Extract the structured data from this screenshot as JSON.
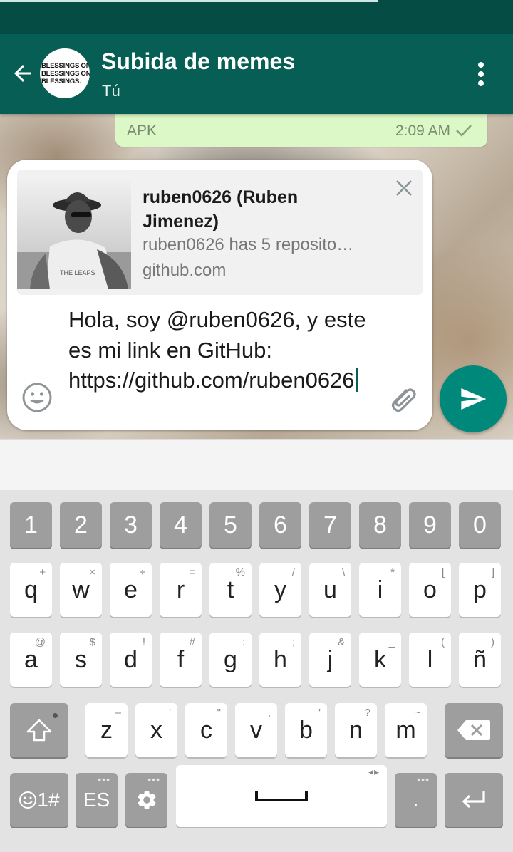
{
  "header": {
    "title": "Subida de memes",
    "subtitle": "Tú",
    "avatar_text": [
      "BLESSINGS ON",
      "BLESSINGS ON",
      "BLESSINGS."
    ]
  },
  "message": {
    "text": "APK",
    "time": "2:09 AM",
    "status_icon": "single-check-icon"
  },
  "link_preview": {
    "title": "ruben0626 (Ruben Jimenez)",
    "description": "ruben0626 has 5 reposito…",
    "domain": "github.com"
  },
  "composer": {
    "text": "Hola, soy @ruben0626, y este es mi link en GitHub: https://github.com/ruben0626"
  },
  "keyboard": {
    "numbers": [
      "1",
      "2",
      "3",
      "4",
      "5",
      "6",
      "7",
      "8",
      "9",
      "0"
    ],
    "row1": [
      {
        "k": "q",
        "h": "+"
      },
      {
        "k": "w",
        "h": "×"
      },
      {
        "k": "e",
        "h": "÷"
      },
      {
        "k": "r",
        "h": "="
      },
      {
        "k": "t",
        "h": "%"
      },
      {
        "k": "y",
        "h": "/"
      },
      {
        "k": "u",
        "h": "\\"
      },
      {
        "k": "i",
        "h": "*"
      },
      {
        "k": "o",
        "h": "["
      },
      {
        "k": "p",
        "h": "]"
      }
    ],
    "row2": [
      {
        "k": "a",
        "h": "@"
      },
      {
        "k": "s",
        "h": "$"
      },
      {
        "k": "d",
        "h": "!"
      },
      {
        "k": "f",
        "h": "#"
      },
      {
        "k": "g",
        "h": ":"
      },
      {
        "k": "h",
        "h": ";"
      },
      {
        "k": "j",
        "h": "&"
      },
      {
        "k": "k",
        "h": "_"
      },
      {
        "k": "l",
        "h": "("
      },
      {
        "k": "ñ",
        "h": ")"
      }
    ],
    "row3": [
      {
        "k": "z",
        "h": "–"
      },
      {
        "k": "x",
        "h": "'"
      },
      {
        "k": "c",
        "h": "\""
      },
      {
        "k": "v",
        "h": ","
      },
      {
        "k": "b",
        "h": "'"
      },
      {
        "k": "n",
        "h": "?"
      },
      {
        "k": "m",
        "h": "~"
      }
    ],
    "symbols_label": "1#",
    "language_label": "ES",
    "period_label": "."
  },
  "colors": {
    "appbar": "#075e54",
    "statusbar": "#054d44",
    "accent": "#00897b",
    "bubble": "#dcf8c6"
  }
}
